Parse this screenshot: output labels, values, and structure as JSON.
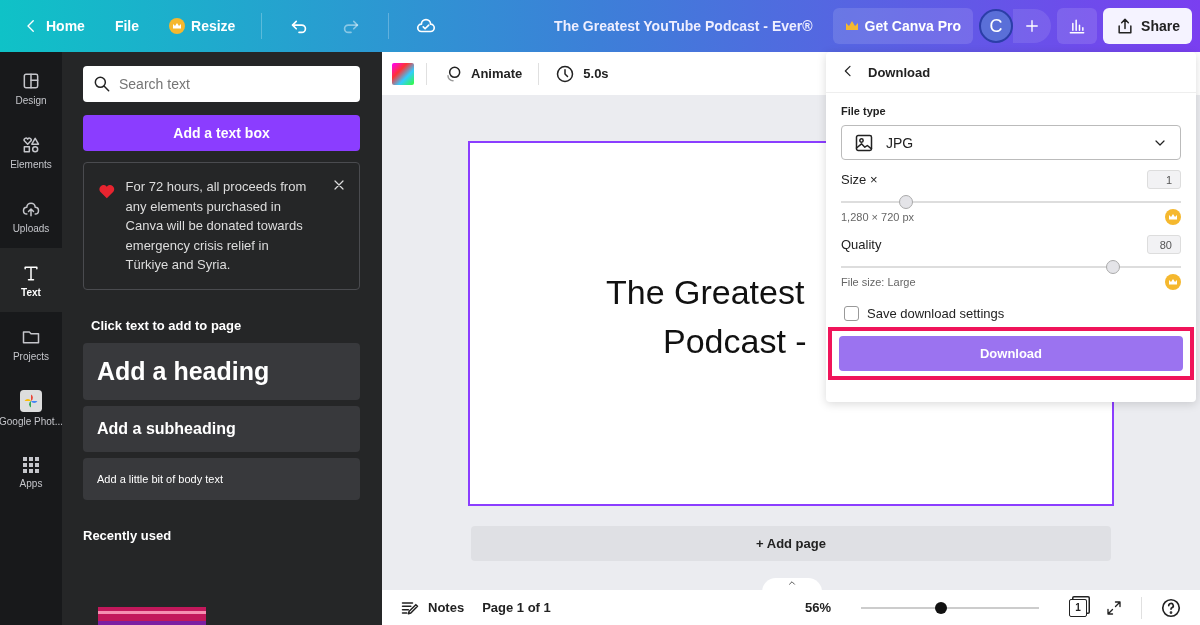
{
  "top_bar": {
    "home": "Home",
    "file": "File",
    "resize": "Resize",
    "title": "The Greatest YouTube Podcast - Ever®",
    "pro": "Get Canva Pro",
    "avatar": "C",
    "share": "Share"
  },
  "rail": [
    {
      "label": "Design",
      "kind": "layout",
      "selected": false
    },
    {
      "label": "Elements",
      "kind": "shapes",
      "selected": false
    },
    {
      "label": "Uploads",
      "kind": "uploads",
      "selected": false
    },
    {
      "label": "Text",
      "kind": "text",
      "selected": true
    },
    {
      "label": "Projects",
      "kind": "folder",
      "selected": false
    },
    {
      "label": "Google Phot...",
      "kind": "photos",
      "selected": false
    },
    {
      "label": "Apps",
      "kind": "apps",
      "selected": false
    }
  ],
  "panel": {
    "search": {
      "placeholder": "Search text"
    },
    "add_text_box": "Add a text box",
    "notice": "For 72 hours, all proceeds from any elements purchased in Canva will be donated towards emergency crisis relief in Türkiye and Syria.",
    "section_title": "Click text to add to page",
    "presets": [
      {
        "label": "Add a heading",
        "kind": "heading"
      },
      {
        "label": "Add a subheading",
        "kind": "subheading"
      },
      {
        "label": "Add a little bit of body text",
        "kind": "body"
      }
    ],
    "recent_title": "Recently used"
  },
  "toolbar": {
    "animate": "Animate",
    "duration": "5.0s"
  },
  "canvas": {
    "lines": [
      "The Greatest",
      "Podcast -"
    ],
    "add_page": "+ Add page"
  },
  "download": {
    "title": "Download",
    "file_type_label": "File type",
    "file_type": "JPG",
    "size_label": "Size ×",
    "size_value": "1",
    "size_slider": {
      "level": 0.19
    },
    "dimensions": "1,280 × 720 px",
    "quality_label": "Quality",
    "quality_value": "80",
    "quality_slider": {
      "level": 0.8
    },
    "file_size": "File size: Large",
    "save_settings": {
      "label": "Save download settings",
      "checked": false
    },
    "button": "Download"
  },
  "bottom_bar": {
    "notes": "Notes",
    "page": "Page 1 of 1",
    "zoom": "56%",
    "zoom_slider": {
      "level": 0.45
    },
    "page_count": "1"
  }
}
